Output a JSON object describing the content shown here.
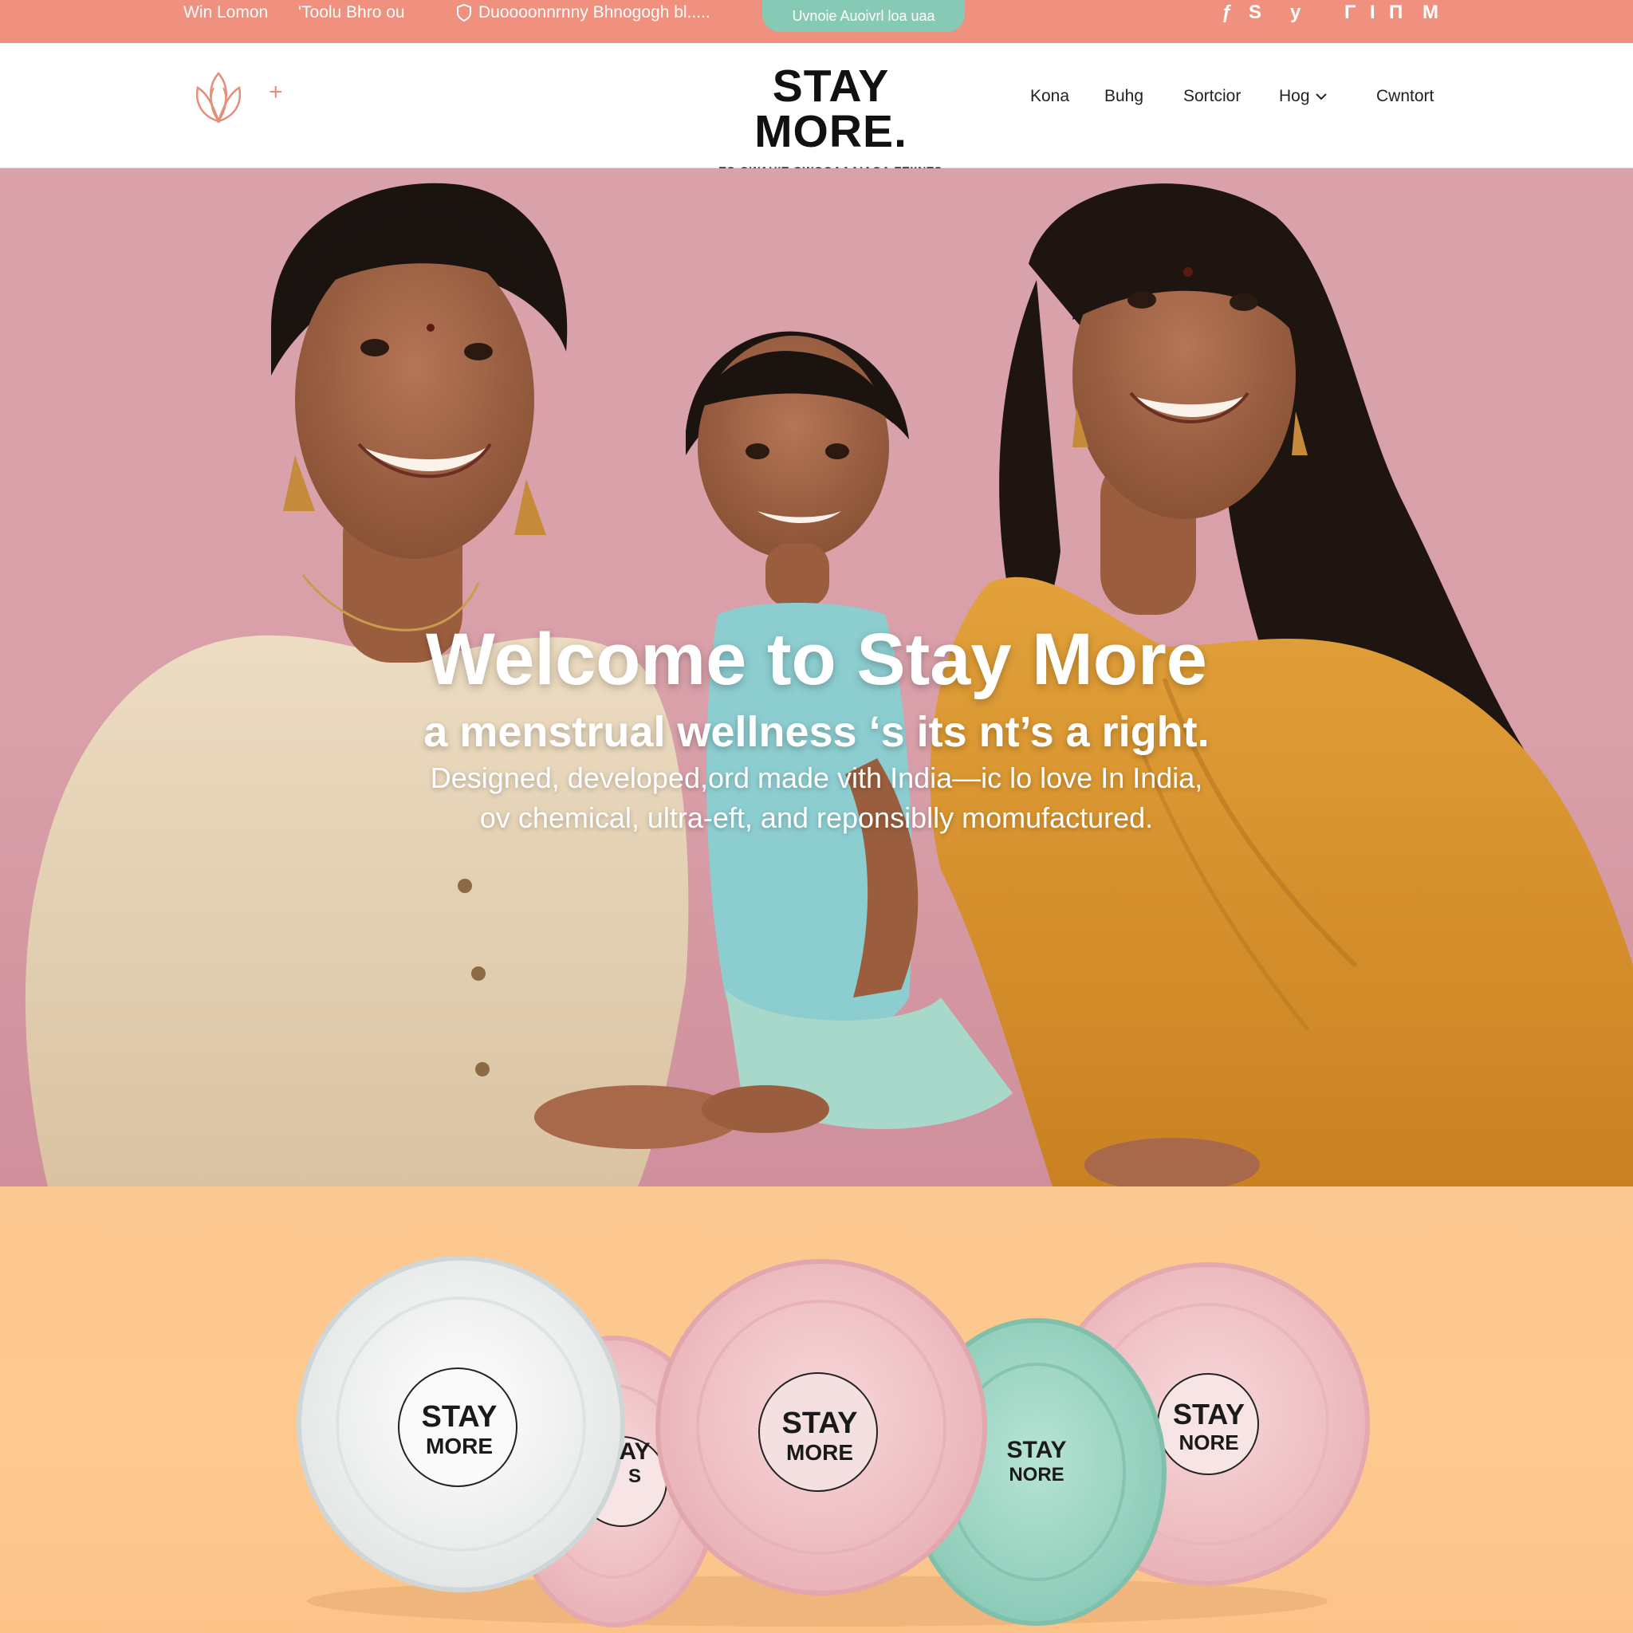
{
  "topbar": {
    "text_1": "Win Lomon",
    "text_2": "'Toolu Bhro ou",
    "text_3": "Duoooonnrnny Bhnogogh bl.....",
    "cta_label": "Uvnoie Auoivrl loa uaa",
    "social_icons": [
      "s1-icon",
      "s2-icon",
      "s3-icon",
      "s4-icon",
      "s5-icon",
      "s6-icon",
      "s7-icon"
    ],
    "social_glyphs": [
      "ƒ",
      "S",
      "y",
      "Γ",
      "I",
      "Π",
      "M"
    ],
    "bg_color": "#f0907e",
    "cta_color": "#86c9b5"
  },
  "header": {
    "logo": "STAY MORE.",
    "logo_sub": "TO OWAUIT OWOOAAAIAOA ETIINTS",
    "nav": [
      "Kona",
      "Buhg",
      "Sortcior",
      "Hog",
      "Cwntort"
    ]
  },
  "hero": {
    "title": "Welcome  to  Stay More",
    "subtitle": "a menstrual wellness ‘s  its nt’s a right.",
    "body_line_1": "Designed, developed,ord made vith India—ic lo love In India,",
    "body_line_2": "ov chemical, ultra-eft, and reponsiblly momufactured.",
    "bg_color": "#d9a2aa"
  },
  "products": {
    "pads": [
      {
        "name": "white",
        "top": "STAY",
        "bottom": "MORE",
        "color": "#f3f3f3"
      },
      {
        "name": "pink-small",
        "top": "AY",
        "bottom": "S",
        "color": "#f1c2c7"
      },
      {
        "name": "pink",
        "top": "STAY",
        "bottom": "MORE",
        "color": "#f3c3c6"
      },
      {
        "name": "mint",
        "top": "STAY",
        "bottom": "NORE",
        "color": "#9fd8c6"
      },
      {
        "name": "pink-right",
        "top": "STAY",
        "bottom": "NORE",
        "color": "#f2c0c4"
      }
    ],
    "bg_color": "#fdc98e"
  }
}
